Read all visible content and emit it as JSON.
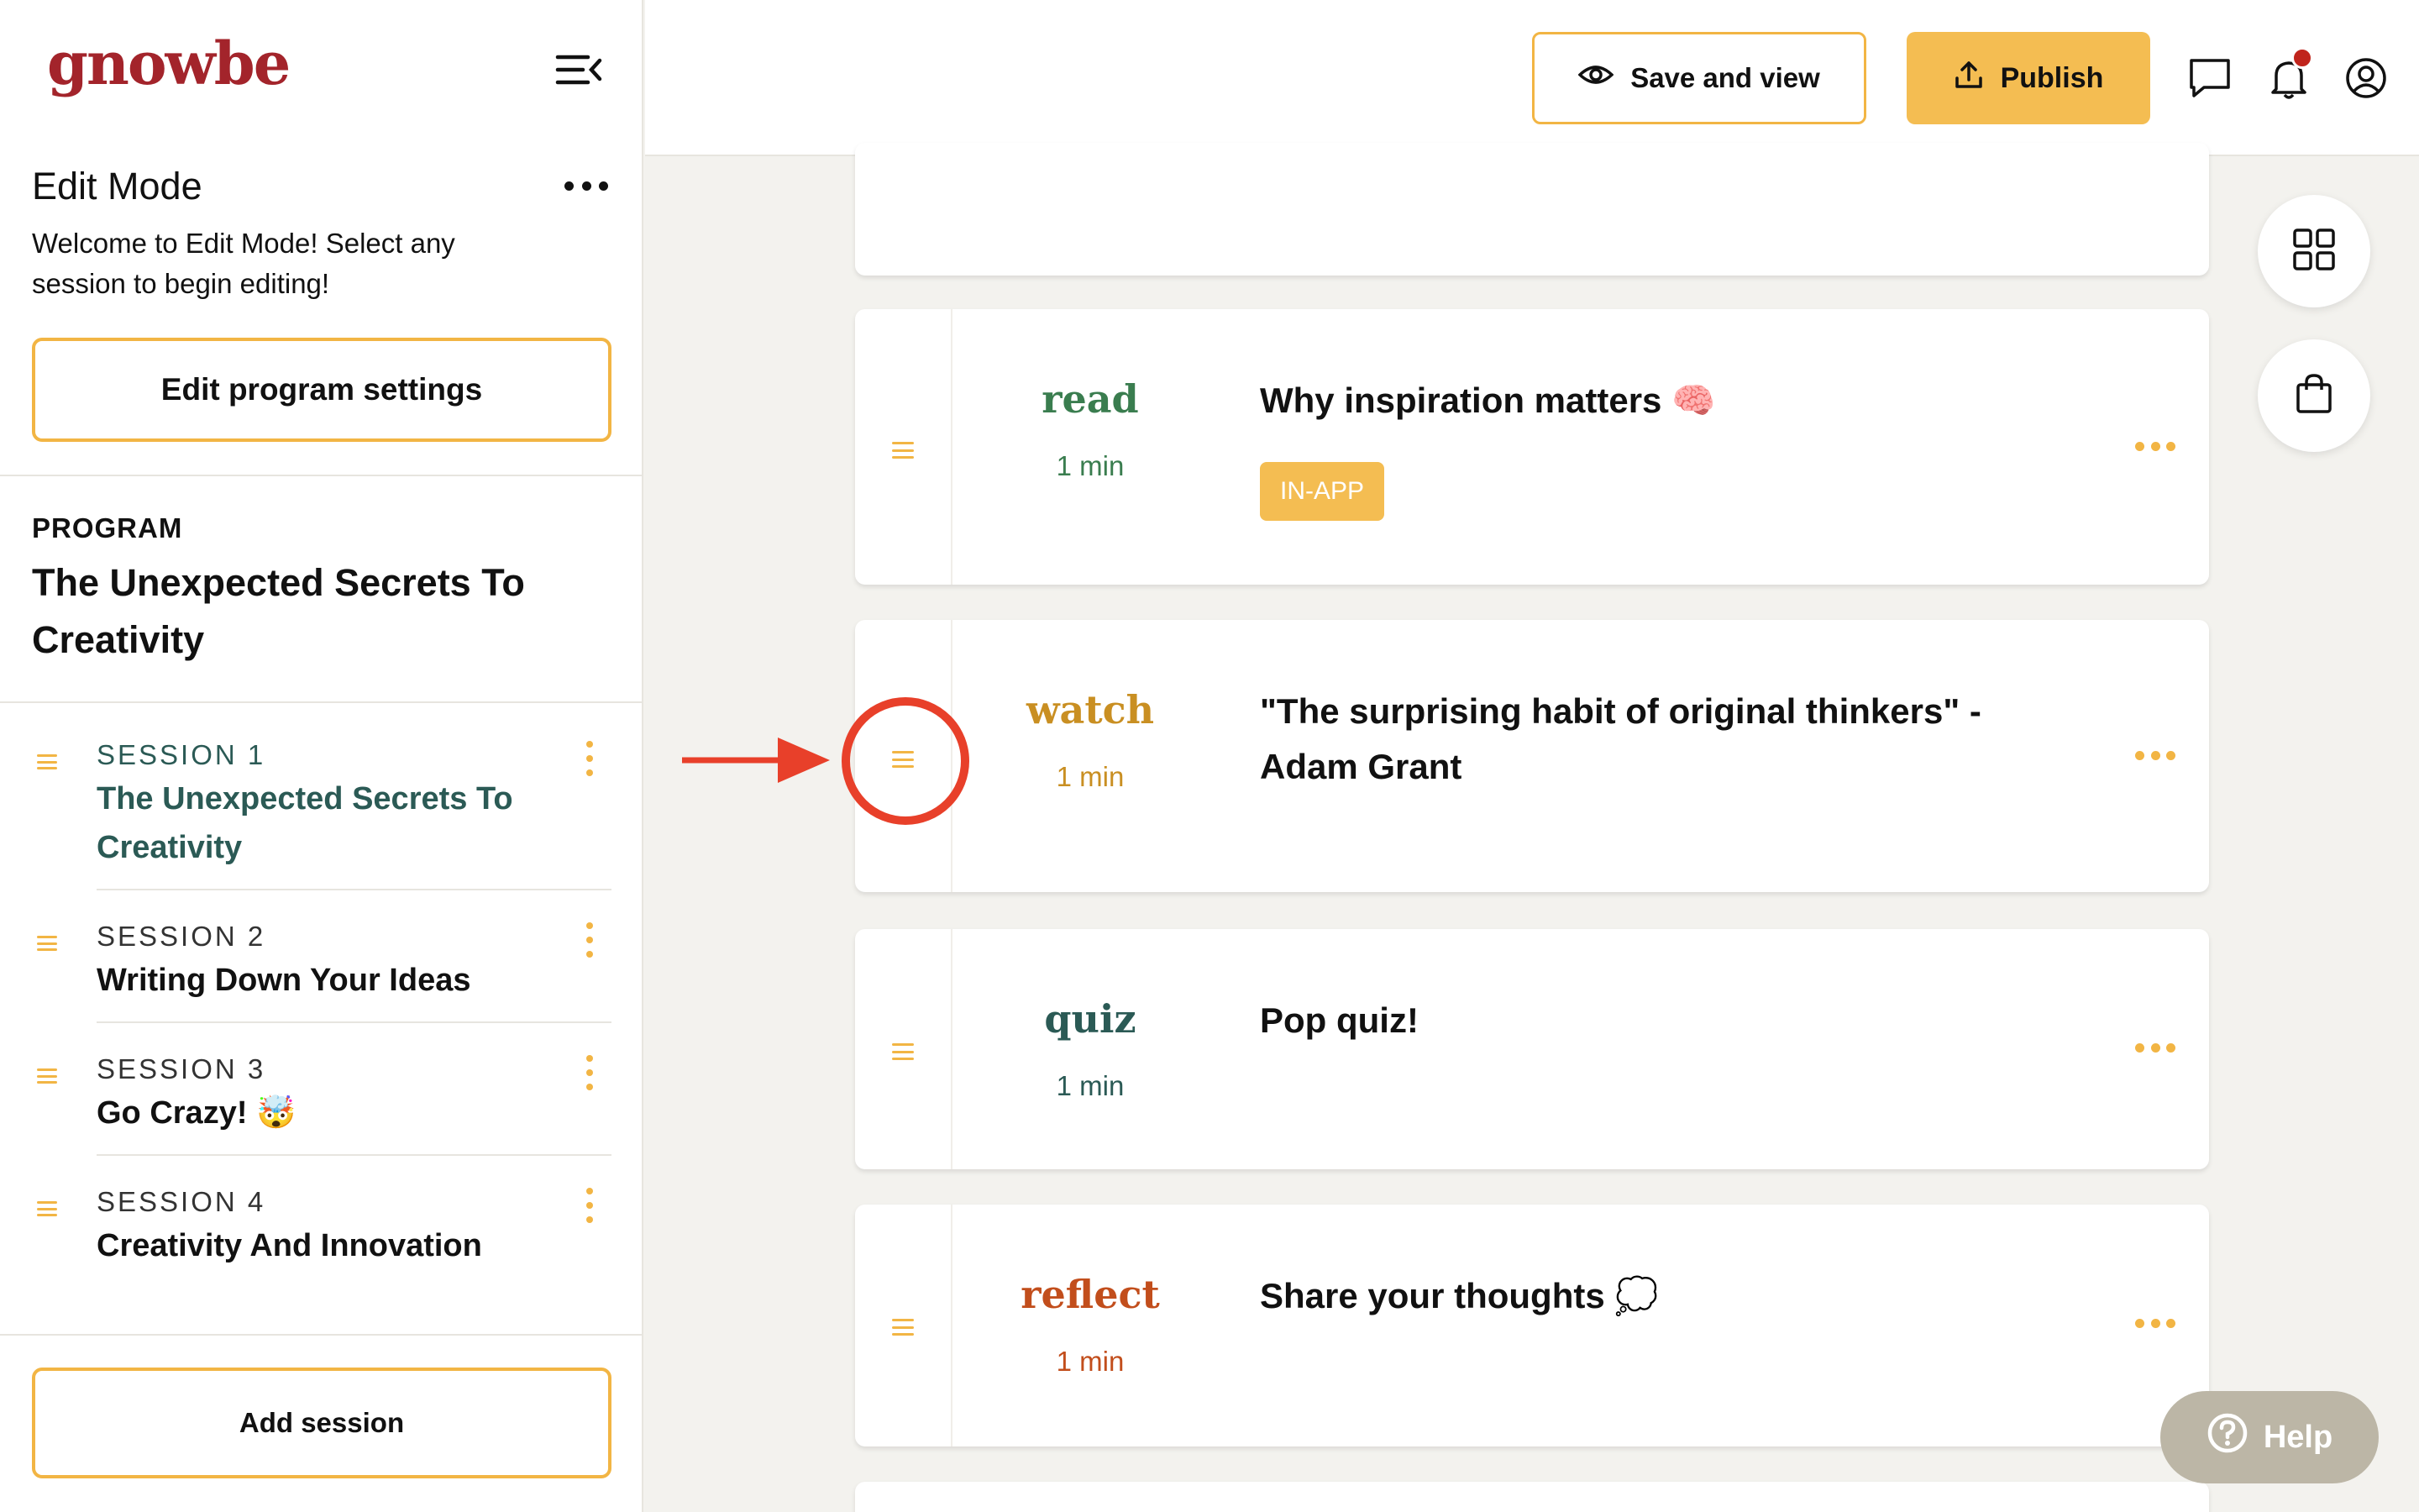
{
  "app": {
    "logo": "gnowbe"
  },
  "sidebar": {
    "edit_mode_title": "Edit Mode",
    "edit_mode_desc": "Welcome to Edit Mode! Select any session to begin editing!",
    "edit_settings_label": "Edit program settings",
    "program_label": "PROGRAM",
    "program_title": "The Unexpected Secrets To Creativity",
    "sessions": [
      {
        "label": "SESSION 1",
        "name": "The Unexpected Secrets To Creativity",
        "active": true
      },
      {
        "label": "SESSION 2",
        "name": "Writing Down Your Ideas",
        "active": false
      },
      {
        "label": "SESSION 3",
        "name": "Go Crazy! 🤯",
        "active": false
      },
      {
        "label": "SESSION 4",
        "name": "Creativity And Innovation",
        "active": false
      }
    ],
    "add_session_label": "Add session"
  },
  "topbar": {
    "save_view_label": "Save and view",
    "publish_label": "Publish"
  },
  "cards": [
    {
      "type": "read",
      "type_color": "#3a7d4f",
      "duration": "1 min",
      "title": "Why inspiration matters 🧠",
      "badge": "IN-APP"
    },
    {
      "type": "watch",
      "type_color": "#c98f22",
      "duration": "1 min",
      "title": "\"The surprising habit of original thinkers\" - Adam Grant"
    },
    {
      "type": "quiz",
      "type_color": "#2b5a55",
      "duration": "1 min",
      "title": "Pop quiz!"
    },
    {
      "type": "reflect",
      "type_color": "#c24e1c",
      "duration": "1 min",
      "title": "Share your thoughts 💭"
    }
  ],
  "help": {
    "label": "Help"
  },
  "colors": {
    "accent": "#f2b544",
    "brand": "#a3242b",
    "annotation": "#e8402a"
  },
  "icons": [
    "menu-collapse-icon",
    "eye-icon",
    "upload-icon",
    "chat-icon",
    "bell-icon",
    "user-circle-icon",
    "grid-icon",
    "shopping-bag-icon",
    "question-circle-icon"
  ]
}
